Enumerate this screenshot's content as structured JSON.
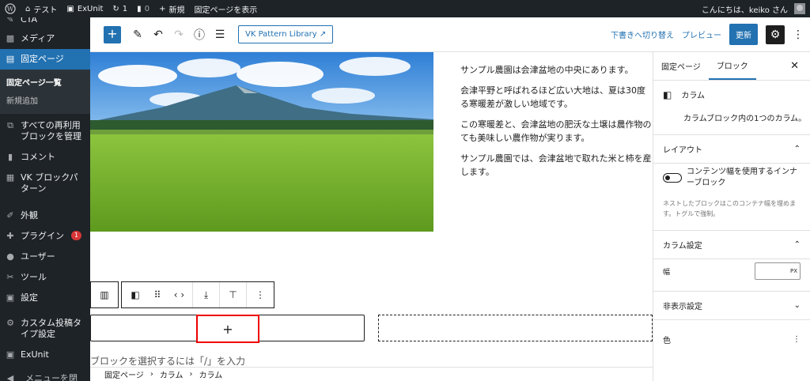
{
  "adminbar": {
    "site_name": "テスト",
    "exunit": "ExUnit",
    "updates": "1",
    "comments": "0",
    "new": "新規",
    "view_page": "固定ページを表示",
    "greeting": "こんにちは、keiko さん"
  },
  "sidebar": {
    "items": [
      {
        "label": "CTA",
        "icon": "cta-icon"
      },
      {
        "label": "メディア",
        "icon": "media-icon"
      },
      {
        "label": "固定ページ",
        "icon": "pages-icon"
      },
      {
        "label": "すべての再利用ブロックを管理",
        "icon": "reusable-icon"
      },
      {
        "label": "コメント",
        "icon": "comments-icon"
      },
      {
        "label": "VK ブロックパターン",
        "icon": "grid-icon"
      },
      {
        "label": "外観",
        "icon": "appearance-icon"
      },
      {
        "label": "プラグイン",
        "icon": "plugins-icon",
        "badge": "1"
      },
      {
        "label": "ユーザー",
        "icon": "users-icon"
      },
      {
        "label": "ツール",
        "icon": "tools-icon"
      },
      {
        "label": "設定",
        "icon": "settings-icon"
      },
      {
        "label": "カスタム投稿タイプ設定",
        "icon": "gear-icon"
      },
      {
        "label": "ExUnit",
        "icon": "exunit-icon"
      },
      {
        "label": "メニューを閉じる",
        "icon": "collapse-icon"
      }
    ],
    "submenu": [
      "固定ページ一覧",
      "新規追加"
    ]
  },
  "toolbar": {
    "add": "+",
    "vk_pattern_library": "VK Pattern Library",
    "save_draft": "下書きへ切り替え",
    "preview": "プレビュー",
    "update": "更新"
  },
  "content": {
    "paragraphs": [
      "サンプル農園は会津盆地の中央にあります。",
      "会津平野と呼ばれるほど広い大地は、夏は30度",
      "る寒暖差が激しい地域です。",
      "この寒暖差と、会津盆地の肥沃な土壌は農作物の",
      "ても美味しい農作物が実ります。",
      "サンプル農園では、会津盆地で取れた米と柿を産",
      "します。"
    ],
    "add_block": "+",
    "placeholder": "ブロックを選択するには「/」を入力"
  },
  "breadcrumb": [
    "固定ページ",
    "カラム",
    "カラム"
  ],
  "inspector": {
    "tabs": [
      "固定ページ",
      "ブロック"
    ],
    "close": "✕",
    "block_name": "カラム",
    "block_desc": "カラムブロック内の1つのカラム。",
    "layout": {
      "title": "レイアウト",
      "toggle_label": "コンテンツ幅を使用するインナーブロック",
      "help": "ネストしたブロックはこのコンテナ幅を埋めます。トグルで強制。"
    },
    "column_settings": {
      "title": "カラム設定",
      "width_label": "幅",
      "unit": "PX"
    },
    "hidden_settings": "非表示設定",
    "color": "色"
  }
}
